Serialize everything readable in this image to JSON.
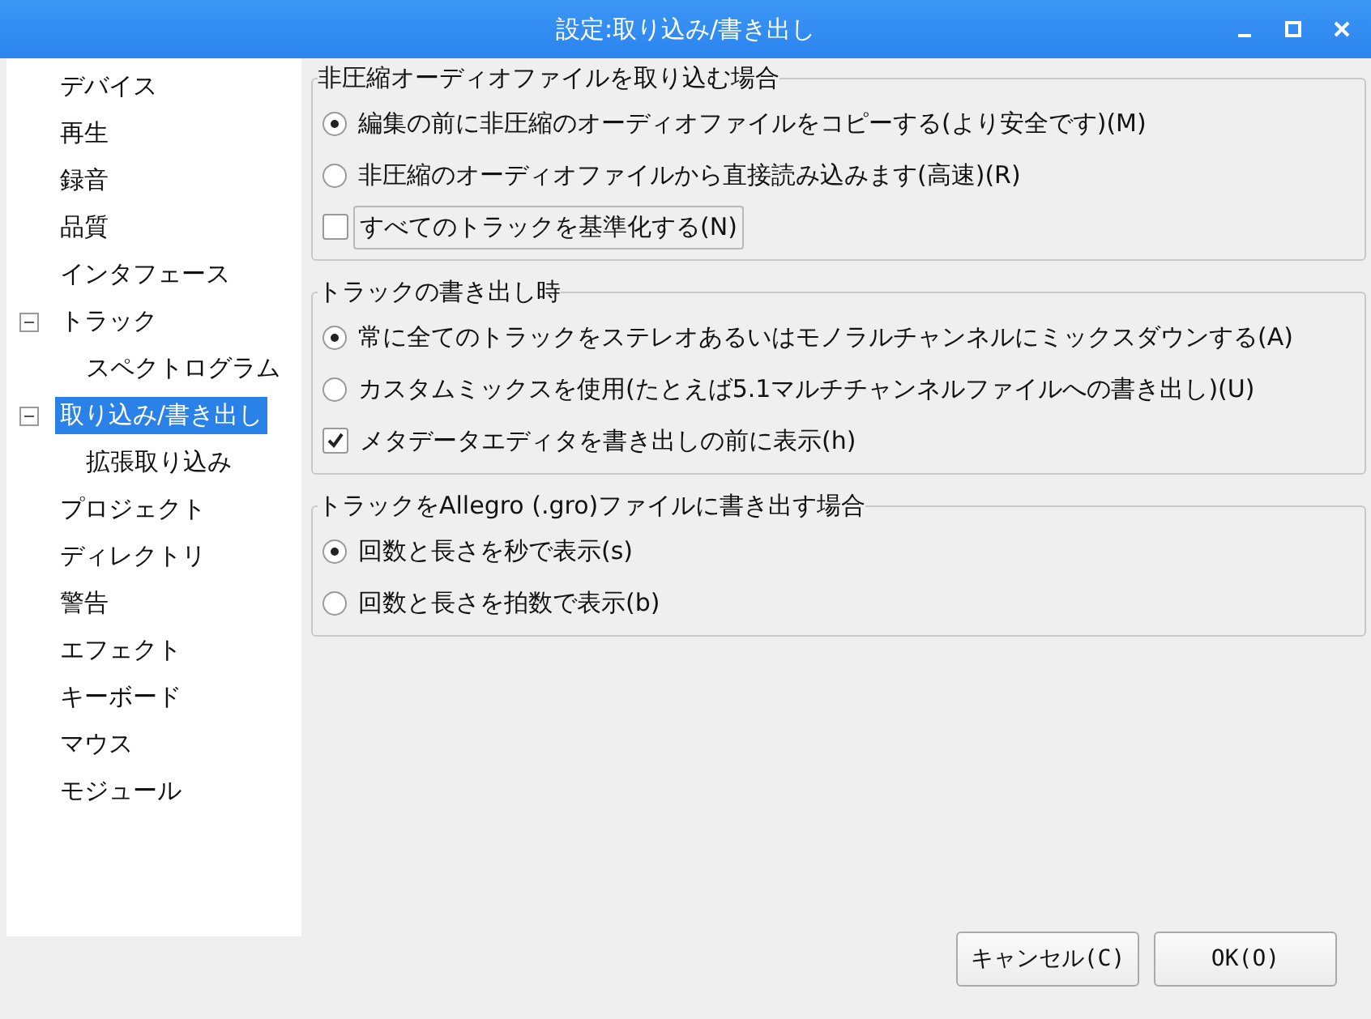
{
  "window": {
    "title": "設定:取り込み/書き出し"
  },
  "sidebar": {
    "items": [
      {
        "label": "デバイス",
        "selected": false
      },
      {
        "label": "再生",
        "selected": false
      },
      {
        "label": "録音",
        "selected": false
      },
      {
        "label": "品質",
        "selected": false
      },
      {
        "label": "インタフェース",
        "selected": false
      },
      {
        "label": "トラック",
        "selected": false,
        "expanded": true,
        "children": [
          {
            "label": "スペクトログラム",
            "selected": false
          }
        ]
      },
      {
        "label": "取り込み/書き出し",
        "selected": true,
        "expanded": true,
        "children": [
          {
            "label": "拡張取り込み",
            "selected": false
          }
        ]
      },
      {
        "label": "プロジェクト",
        "selected": false
      },
      {
        "label": "ディレクトリ",
        "selected": false
      },
      {
        "label": "警告",
        "selected": false
      },
      {
        "label": "エフェクト",
        "selected": false
      },
      {
        "label": "キーボード",
        "selected": false
      },
      {
        "label": "マウス",
        "selected": false
      },
      {
        "label": "モジュール",
        "selected": false
      }
    ]
  },
  "groups": [
    {
      "title": "非圧縮オーディオファイルを取り込む場合",
      "options": [
        {
          "kind": "radio",
          "label": "編集の前に非圧縮のオーディオファイルをコピーする(より安全です)(M)",
          "checked": true,
          "focused": false
        },
        {
          "kind": "radio",
          "label": "非圧縮のオーディオファイルから直接読み込みます(高速)(R)",
          "checked": false,
          "focused": false
        },
        {
          "kind": "checkbox",
          "label": "すべてのトラックを基準化する(N)",
          "checked": false,
          "focused": true
        }
      ]
    },
    {
      "title": "トラックの書き出し時",
      "options": [
        {
          "kind": "radio",
          "label": "常に全てのトラックをステレオあるいはモノラルチャンネルにミックスダウンする(A)",
          "checked": true,
          "focused": false
        },
        {
          "kind": "radio",
          "label": "カスタムミックスを使用(たとえば5.1マルチチャンネルファイルへの書き出し)(U)",
          "checked": false,
          "focused": false
        },
        {
          "kind": "checkbox",
          "label": "メタデータエディタを書き出しの前に表示(h)",
          "checked": true,
          "focused": false
        }
      ]
    },
    {
      "title": "トラックをAllegro (.gro)ファイルに書き出す場合",
      "options": [
        {
          "kind": "radio",
          "label": "回数と長さを秒で表示(s)",
          "checked": true,
          "focused": false
        },
        {
          "kind": "radio",
          "label": "回数と長さを拍数で表示(b)",
          "checked": false,
          "focused": false
        }
      ]
    }
  ],
  "buttons": [
    {
      "label": "キャンセル(C)"
    },
    {
      "label": "OK(O)"
    }
  ]
}
